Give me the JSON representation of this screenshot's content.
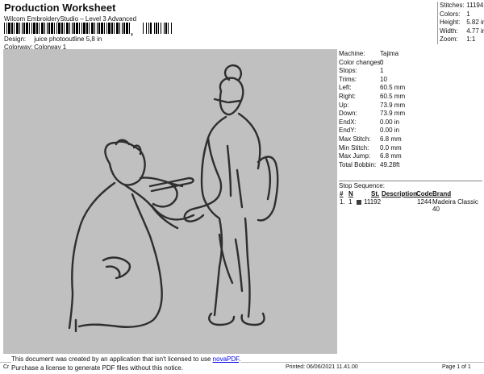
{
  "header": {
    "title": "Production Worksheet",
    "subtitle": "Wilcom EmbroideryStudio – Level 3 Advanced",
    "barcode_digit": ","
  },
  "info": {
    "design_label": "Design:",
    "design_value": "juice photooutline 5,8 in",
    "colorway_label": "Colorway:",
    "colorway_value": "Colorway 1"
  },
  "stats": [
    {
      "label": "Stitches:",
      "value": "11194"
    },
    {
      "label": "Colors:",
      "value": "1"
    },
    {
      "label": "Height:",
      "value": "5.82 in"
    },
    {
      "label": "Width:",
      "value": "4.77 in"
    },
    {
      "label": "Zoom:",
      "value": "1:1"
    }
  ],
  "machine_info": [
    {
      "label": "Machine:",
      "value": "Tajima"
    },
    {
      "label": "Color changes:",
      "value": "0"
    },
    {
      "label": "Stops:",
      "value": "1"
    },
    {
      "label": "Trims:",
      "value": "10"
    },
    {
      "label": "Left:",
      "value": "60.5 mm"
    },
    {
      "label": "Right:",
      "value": "60.5 mm"
    },
    {
      "label": "Up:",
      "value": "73.9 mm"
    },
    {
      "label": "Down:",
      "value": "73.9 mm"
    },
    {
      "label": "EndX:",
      "value": "0.00 in"
    },
    {
      "label": "EndY:",
      "value": "0.00 in"
    },
    {
      "label": "Max Stitch:",
      "value": "6.8 mm"
    },
    {
      "label": "Min Stitch:",
      "value": "0.0 mm"
    },
    {
      "label": "Max Jump:",
      "value": "6.8 mm"
    },
    {
      "label": "Total Bobbin:",
      "value": "49.28ft"
    }
  ],
  "stop_sequence": {
    "title": "Stop Sequence:",
    "headers": [
      "#",
      "N",
      "St.",
      "Description",
      "Code",
      "Brand"
    ],
    "rows": [
      {
        "num": "1.",
        "n": "1",
        "st": "11192",
        "description": "",
        "code": "1244",
        "brand": "Madeira Classic 40",
        "swatch_color": "#3c3c3c"
      }
    ]
  },
  "notice": {
    "line1": "This document was created by an application that isn't licensed to use ",
    "link": "novaPDF",
    "line1_end": ".",
    "line2": "Purchase a license to generate PDF files without this notice."
  },
  "footer": {
    "left": "Cr",
    "printed": "Printed: 06/06/2021 11.41.00",
    "page": "Page 1 of 1"
  },
  "colors": {
    "canvas_bg": "#c0c0c0",
    "thread": "#2e2e2e"
  }
}
